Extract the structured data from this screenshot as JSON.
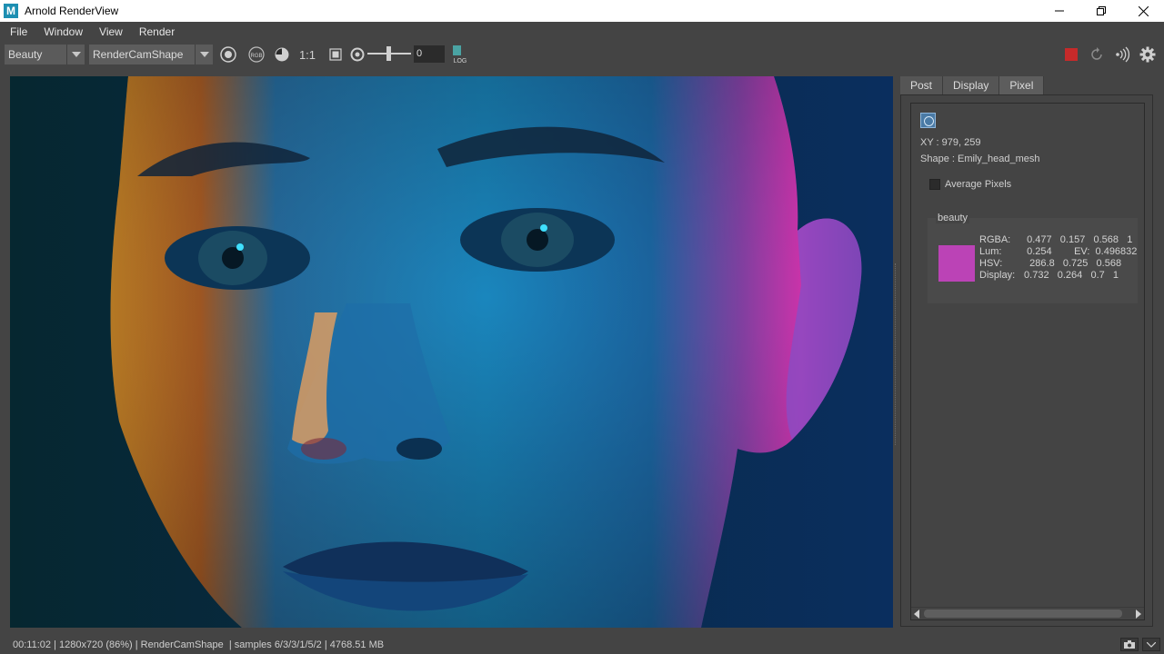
{
  "window": {
    "title": "Arnold RenderView",
    "app_icon": "M"
  },
  "menu": [
    "File",
    "Window",
    "View",
    "Render"
  ],
  "toolbar": {
    "aov_selected": "Beauty",
    "camera_selected": "RenderCamShape",
    "one_to_one_label": "1:1",
    "rgb_label": "RGB",
    "exposure_value": "0",
    "log_label": "LOG",
    "stop_color": "#c62a2a"
  },
  "panel": {
    "tabs": [
      "Post",
      "Display",
      "Pixel"
    ],
    "active_tab": "Pixel",
    "xy": "XY : 979, 259",
    "shape": "Shape : Emily_head_mesh",
    "average_label": "Average Pixels",
    "average_checked": false,
    "aov_name": "beauty",
    "swatch_color": "#bb43b6",
    "rows": [
      {
        "label": "RGBA:",
        "value": "  0.477   0.157   0.568   1"
      },
      {
        "label": "Lum:",
        "value": "  0.254        EV:  0.496832"
      },
      {
        "label": "HSV:",
        "value": "   286.8   0.725   0.568"
      },
      {
        "label": "Display:",
        "value": " 0.732   0.264   0.7   1"
      }
    ]
  },
  "status": "00:11:02 | 1280x720 (86%) | RenderCamShape  | samples 6/3/3/1/5/2 | 4768.51 MB"
}
